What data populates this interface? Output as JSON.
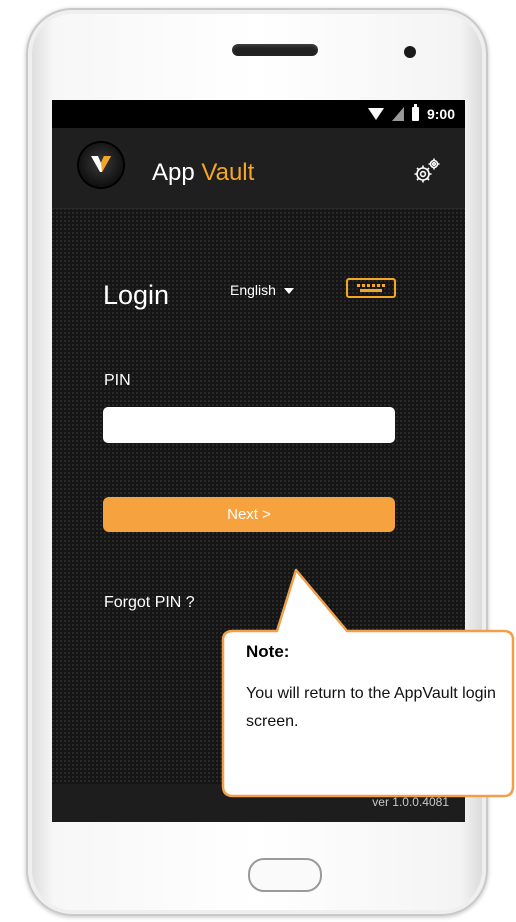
{
  "status_bar": {
    "time": "9:00"
  },
  "app_bar": {
    "title_part1": "App",
    "title_part2": "Vault"
  },
  "login": {
    "heading": "Login",
    "language": "English",
    "pin_label": "PIN",
    "pin_value": "",
    "next_label": "Next >",
    "forgot_label": "Forgot PIN ?"
  },
  "footer": {
    "version": "ver 1.0.0.4081"
  },
  "note": {
    "title": "Note:",
    "body": "You will return to the AppVault login screen."
  },
  "colors": {
    "accent": "#f5a623",
    "button": "#f6a33f",
    "screen_bg": "#151515"
  }
}
